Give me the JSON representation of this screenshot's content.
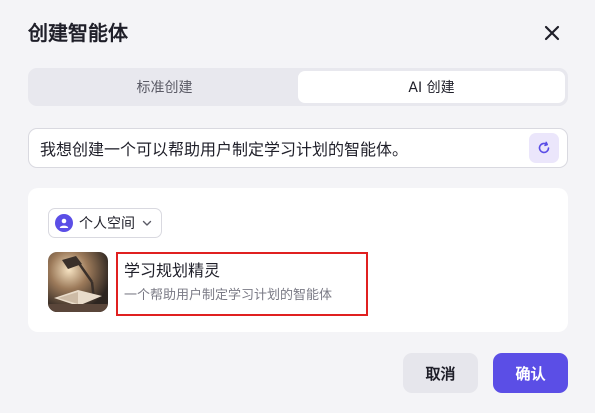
{
  "dialog": {
    "title": "创建智能体"
  },
  "tabs": [
    {
      "label": "标准创建",
      "active": false
    },
    {
      "label": "AI 创建",
      "active": true
    }
  ],
  "prompt": {
    "value": "我想创建一个可以帮助用户制定学习计划的智能体。"
  },
  "space": {
    "label": "个人空间"
  },
  "agent": {
    "name": "学习规划精灵",
    "description": "一个帮助用户制定学习计划的智能体"
  },
  "footer": {
    "cancel_label": "取消",
    "confirm_label": "确认"
  },
  "colors": {
    "accent": "#5b4ee6",
    "highlight_border": "#e02020"
  },
  "icons": {
    "close": "close-icon",
    "refresh": "refresh-icon",
    "user": "user-icon",
    "chevron": "chevron-down-icon"
  }
}
